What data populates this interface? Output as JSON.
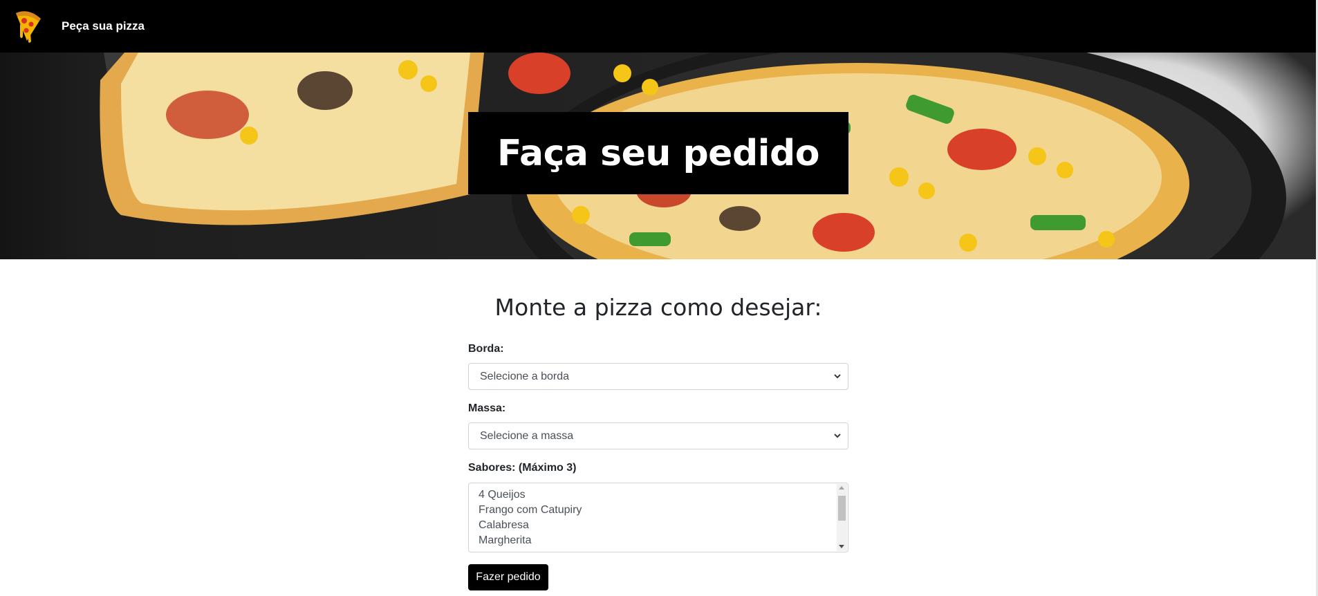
{
  "navbar": {
    "brand": "Peça sua pizza",
    "logo_icon": "pizza-slice-icon"
  },
  "hero": {
    "title": "Faça seu pedido"
  },
  "form": {
    "heading": "Monte a pizza como desejar:",
    "borda": {
      "label": "Borda:",
      "selected": "Selecione a borda"
    },
    "massa": {
      "label": "Massa:",
      "selected": "Selecione a massa"
    },
    "sabores": {
      "label": "Sabores: (Máximo 3)",
      "options": [
        "4 Queijos",
        "Frango com Catupiry",
        "Calabresa",
        "Margherita"
      ]
    },
    "submit_label": "Fazer pedido"
  },
  "colors": {
    "navbar_bg": "#000000",
    "button_bg": "#000000",
    "text": "#212529"
  }
}
